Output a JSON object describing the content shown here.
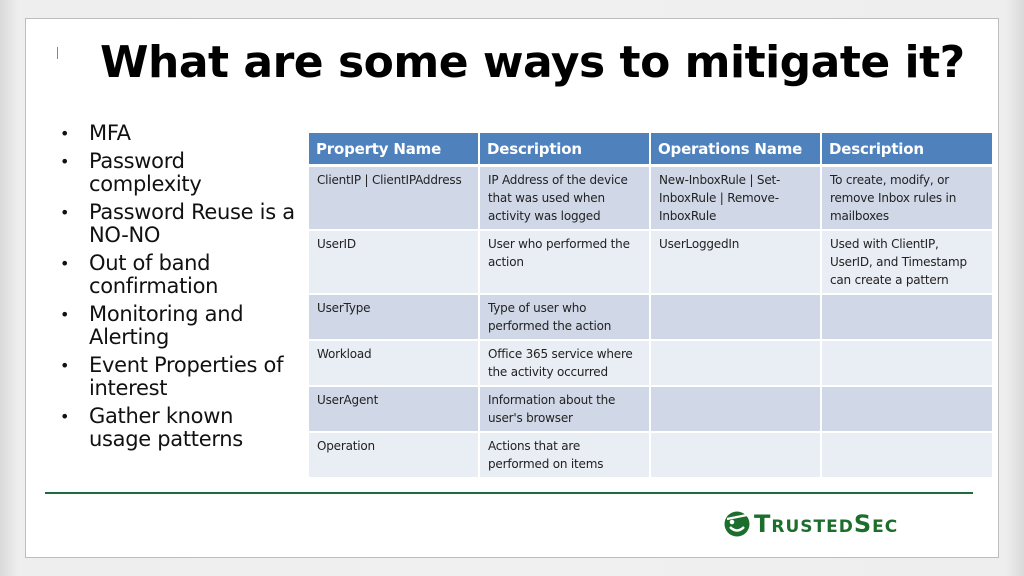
{
  "slide": {
    "title": "What are some ways to mitigate it?",
    "bullets": [
      "MFA",
      "Password complexity",
      "Password Reuse is a NO-NO",
      "Out of band confirmation",
      "Monitoring and Alerting",
      "Event Properties of interest",
      "Gather known usage patterns"
    ],
    "bullet_glyph": "•"
  },
  "table": {
    "headers": [
      "Property Name",
      "Description",
      "Operations  Name",
      "Description"
    ],
    "rows": [
      [
        "ClientIP | ClientIPAddress",
        "IP Address of the device that was used when activity was logged",
        "New-InboxRule | Set-InboxRule | Remove-InboxRule",
        "To create, modify, or remove Inbox rules in mailboxes"
      ],
      [
        "UserID",
        "User who performed the action",
        "UserLoggedIn",
        "Used with ClientIP, UserID, and Timestamp can create a pattern"
      ],
      [
        "UserType",
        "Type of user who performed the action",
        "",
        ""
      ],
      [
        "Workload",
        "Office 365 service where the activity occurred",
        "",
        ""
      ],
      [
        "UserAgent",
        "Information about the user's browser",
        "",
        ""
      ],
      [
        "Operation",
        "Actions that are performed on items",
        "",
        ""
      ]
    ]
  },
  "branding": {
    "logo_icon": "smiley-eyepatch-icon",
    "logo_text": "TrustedSec",
    "brand_color": "#1c6e2d",
    "header_color": "#4f81bd"
  }
}
